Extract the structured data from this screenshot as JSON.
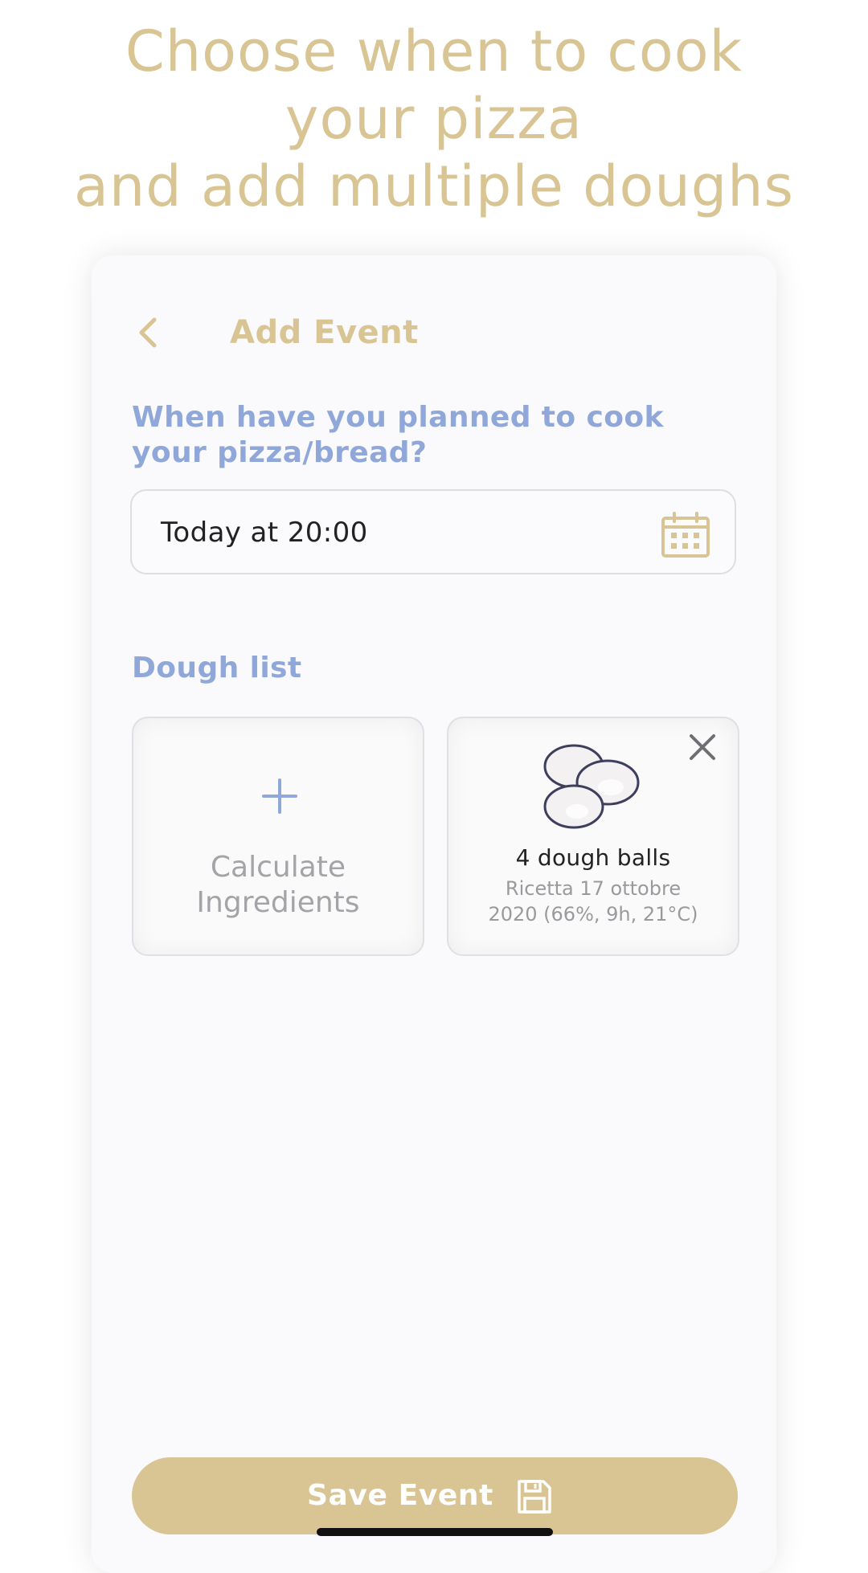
{
  "promo": {
    "line1": "Choose when to cook",
    "line2": "your pizza",
    "line3": "and add multiple doughs"
  },
  "nav": {
    "back_icon": "chevron-left-icon",
    "title": "Add Event"
  },
  "when": {
    "question": "When have you planned to cook your pizza/bread?",
    "value": "Today at 20:00",
    "calendar_icon": "calendar-icon"
  },
  "dough_list": {
    "label": "Dough list",
    "add_card": {
      "icon": "plus-icon",
      "label_line1": "Calculate",
      "label_line2": "Ingredients"
    },
    "items": [
      {
        "icon": "dough-balls-icon",
        "name": "4 dough balls",
        "recipe_line1": "Ricetta 17 ottobre",
        "recipe_line2": "2020 (66%, 9h, 21°C)",
        "remove_icon": "close-icon"
      }
    ]
  },
  "save": {
    "label": "Save Event",
    "icon": "floppy-disk-icon"
  },
  "colors": {
    "accent_gold": "#d9c593",
    "section_blue": "#8fa7d9",
    "background": "#faf9fb"
  }
}
